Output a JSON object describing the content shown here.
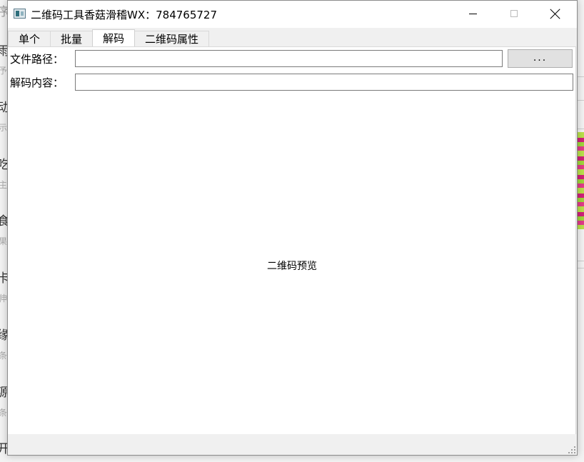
{
  "background": {
    "chars": [
      "序",
      "雨",
      "予",
      "动",
      "示",
      "吃",
      "主",
      "食",
      "果",
      "卡",
      "伸",
      "缘",
      "条",
      "源",
      "条",
      "开"
    ]
  },
  "window": {
    "title": "二维码工具香菇滑稽WX：784765727",
    "icon": "app-icon"
  },
  "tabs": [
    {
      "label": "单个",
      "active": false
    },
    {
      "label": "批量",
      "active": false
    },
    {
      "label": "解码",
      "active": true
    },
    {
      "label": "二维码属性",
      "active": false
    }
  ],
  "decode": {
    "file_path_label": "文件路径：",
    "file_path_value": "",
    "browse_label": "...",
    "content_label": "解码内容：",
    "content_value": "",
    "preview_label": "二维码预览"
  }
}
